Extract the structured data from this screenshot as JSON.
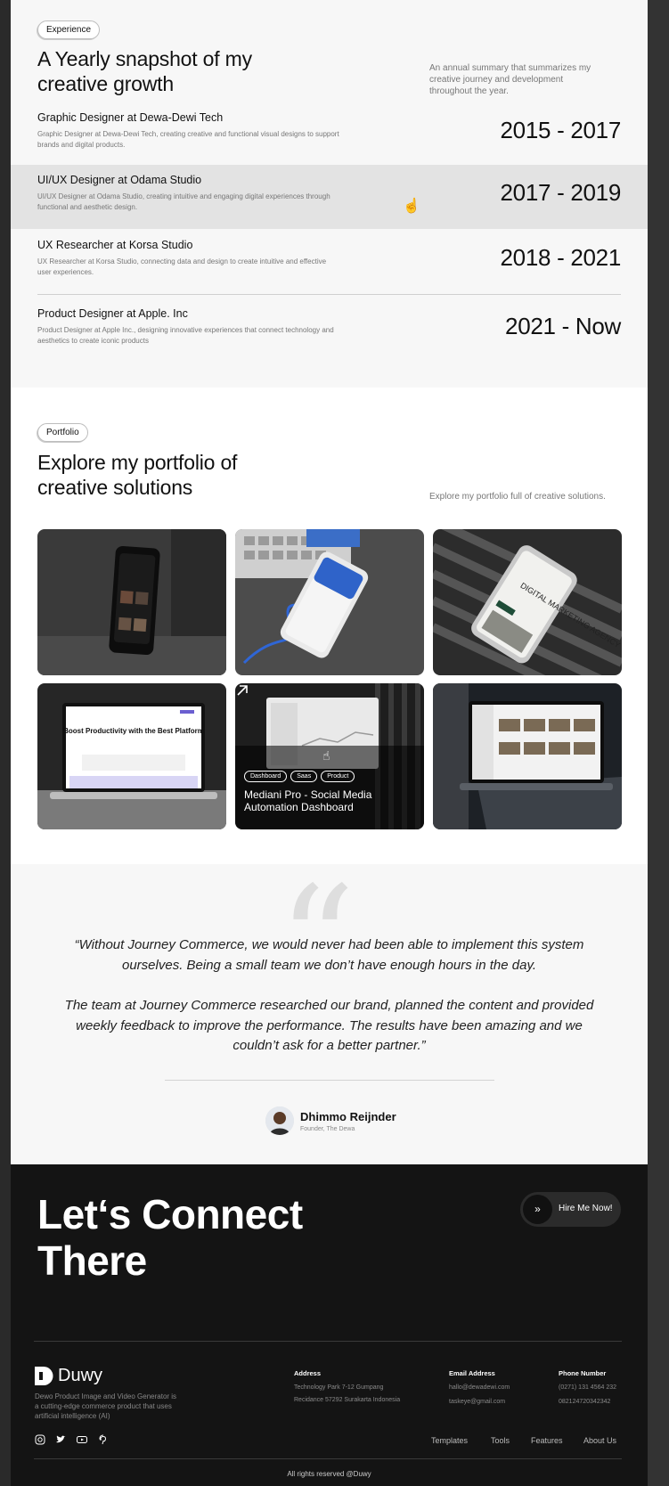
{
  "experience": {
    "badge": "Experience",
    "heading": "A Yearly snapshot of my creative growth",
    "note": "An annual summary that summarizes my creative journey and development throughout the year.",
    "items": [
      {
        "title": "Graphic Designer at Dewa-Dewi Tech",
        "desc": "Graphic Designer at Dewa-Dewi Tech, creating creative and functional visual designs to support brands and digital products.",
        "years": "2015 - 2017"
      },
      {
        "title": "UI/UX Designer at Odama Studio",
        "desc": "UI/UX Designer at Odama Studio, creating intuitive and engaging digital experiences through functional and aesthetic design.",
        "years": "2017 - 2019"
      },
      {
        "title": "UX Researcher at Korsa Studio",
        "desc": "UX Researcher at Korsa Studio, connecting data and design to create intuitive and effective user experiences.",
        "years": "2018 - 2021"
      },
      {
        "title": "Product Designer at Apple. Inc",
        "desc": "Product Designer at Apple Inc., designing innovative experiences that connect technology and aesthetics to create iconic products",
        "years": "2021 - Now"
      }
    ]
  },
  "portfolio": {
    "badge": "Portfolio",
    "heading": "Explore my portfolio of creative solutions",
    "note": "Explore my portfolio full of creative solutions.",
    "featured": {
      "tags": [
        "Dashboard",
        "Saas",
        "Product"
      ],
      "title": "Mediani Pro - Social Media Automation Dashboard"
    },
    "mock_text": {
      "agency": "DIGITAL MARKETING AGENCY",
      "boost": "Boost Productivity with the Best Platform"
    }
  },
  "testimonial": {
    "quote_1": "“Without Journey Commerce, we would never had been able to implement this system ourselves. Being a small team we don’t have enough hours in the day.",
    "quote_2": "The team at Journey Commerce researched our brand, planned the content and provided weekly feedback to improve the performance. The results have been amazing and we couldn’t ask for a better partner.”",
    "name": "Dhimmo Reijnder",
    "role": "Founder, The Dewa"
  },
  "footer": {
    "cta_heading": "Let‘s Connect There",
    "hire_label": "Hire Me Now!",
    "brand": "Duwy",
    "brand_desc": "Dewo Product Image and Video Generator is a cutting-edge commerce product that uses artificial intelligence (AI)",
    "address_label": "Address",
    "address_1": "Technology Park 7-12 Gumpang",
    "address_2": "Recidance 57292 Surakarta Indonesia",
    "email_label": "Email Address",
    "email_1": "hallo@dewadewi.com",
    "email_2": "taskeye@gmail.com",
    "phone_label": "Phone Number",
    "phone_1": "(0271) 131 4564 232",
    "phone_2": "082124720342342",
    "links": [
      "Templates",
      "Tools",
      "Features",
      "About Us"
    ],
    "copyright": "All rights reserved @Duwy"
  },
  "colors": {
    "background": "#f7f7f7",
    "footer": "#141414",
    "accent": "#111111"
  }
}
